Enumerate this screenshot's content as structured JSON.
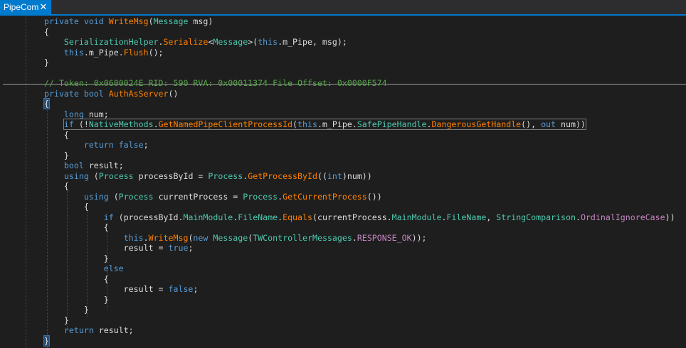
{
  "tab": {
    "title": "PipeCom",
    "close": "✕"
  },
  "code_lines": [
    [
      {
        "t": "private void ",
        "c": "kw"
      },
      {
        "t": "WriteMsg",
        "c": "mt"
      },
      {
        "t": "(",
        "c": "pl"
      },
      {
        "t": "Message",
        "c": "ty"
      },
      {
        "t": " msg)",
        "c": "pl"
      }
    ],
    [
      {
        "t": "{",
        "c": "pl"
      }
    ],
    [
      {
        "t": "    ",
        "c": "pl"
      },
      {
        "t": "SerializationHelper",
        "c": "ty"
      },
      {
        "t": ".",
        "c": "pl"
      },
      {
        "t": "Serialize",
        "c": "mt"
      },
      {
        "t": "<",
        "c": "pl"
      },
      {
        "t": "Message",
        "c": "ty"
      },
      {
        "t": ">(",
        "c": "pl"
      },
      {
        "t": "this",
        "c": "kw"
      },
      {
        "t": ".m_Pipe, msg);",
        "c": "pl"
      }
    ],
    [
      {
        "t": "    ",
        "c": "pl"
      },
      {
        "t": "this",
        "c": "kw"
      },
      {
        "t": ".m_Pipe.",
        "c": "pl"
      },
      {
        "t": "Flush",
        "c": "mt"
      },
      {
        "t": "();",
        "c": "pl"
      }
    ],
    [
      {
        "t": "}",
        "c": "pl"
      }
    ],
    [
      {
        "t": "",
        "c": "pl"
      }
    ],
    [
      {
        "t": "// Token: 0x0600024E RID: 590 RVA: 0x00011374 File Offset: 0x0000F574",
        "c": "cm"
      }
    ],
    [
      {
        "t": "private bool ",
        "c": "kw"
      },
      {
        "t": "AuthAsServer",
        "c": "mt"
      },
      {
        "t": "()",
        "c": "pl"
      }
    ],
    [
      {
        "t": "{",
        "c": "pl",
        "brace": true
      }
    ],
    [
      {
        "t": "    ",
        "c": "pl"
      },
      {
        "t": "long",
        "c": "kw"
      },
      {
        "t": " num;",
        "c": "pl"
      }
    ],
    [
      {
        "t": "    ",
        "c": "pl"
      },
      {
        "t": "if",
        "c": "kw",
        "hl": true
      },
      {
        "t": " (!",
        "c": "pl",
        "hl": true
      },
      {
        "t": "NativeMethods",
        "c": "ty",
        "hl": true
      },
      {
        "t": ".",
        "c": "pl",
        "hl": true
      },
      {
        "t": "GetNamedPipeClientProcessId",
        "c": "mt",
        "hl": true
      },
      {
        "t": "(",
        "c": "pl",
        "hl": true
      },
      {
        "t": "this",
        "c": "kw",
        "hl": true
      },
      {
        "t": ".m_Pipe.",
        "c": "pl",
        "hl": true
      },
      {
        "t": "SafePipeHandle",
        "c": "pr",
        "hl": true
      },
      {
        "t": ".",
        "c": "pl",
        "hl": true
      },
      {
        "t": "DangerousGetHandle",
        "c": "mt",
        "hl": true
      },
      {
        "t": "(), ",
        "c": "pl",
        "hl": true
      },
      {
        "t": "out",
        "c": "kw",
        "hl": true
      },
      {
        "t": " num))",
        "c": "pl",
        "hl": true
      }
    ],
    [
      {
        "t": "    {",
        "c": "pl"
      }
    ],
    [
      {
        "t": "        ",
        "c": "pl"
      },
      {
        "t": "return false",
        "c": "kw"
      },
      {
        "t": ";",
        "c": "pl"
      }
    ],
    [
      {
        "t": "    }",
        "c": "pl"
      }
    ],
    [
      {
        "t": "    ",
        "c": "pl"
      },
      {
        "t": "bool",
        "c": "kw"
      },
      {
        "t": " result;",
        "c": "pl"
      }
    ],
    [
      {
        "t": "    ",
        "c": "pl"
      },
      {
        "t": "using",
        "c": "kw"
      },
      {
        "t": " (",
        "c": "pl"
      },
      {
        "t": "Process",
        "c": "ty"
      },
      {
        "t": " processById = ",
        "c": "pl"
      },
      {
        "t": "Process",
        "c": "ty"
      },
      {
        "t": ".",
        "c": "pl"
      },
      {
        "t": "GetProcessById",
        "c": "mt"
      },
      {
        "t": "((",
        "c": "pl"
      },
      {
        "t": "int",
        "c": "kw"
      },
      {
        "t": ")num))",
        "c": "pl"
      }
    ],
    [
      {
        "t": "    {",
        "c": "pl"
      }
    ],
    [
      {
        "t": "        ",
        "c": "pl"
      },
      {
        "t": "using",
        "c": "kw"
      },
      {
        "t": " (",
        "c": "pl"
      },
      {
        "t": "Process",
        "c": "ty"
      },
      {
        "t": " currentProcess = ",
        "c": "pl"
      },
      {
        "t": "Process",
        "c": "ty"
      },
      {
        "t": ".",
        "c": "pl"
      },
      {
        "t": "GetCurrentProcess",
        "c": "mt"
      },
      {
        "t": "())",
        "c": "pl"
      }
    ],
    [
      {
        "t": "        {",
        "c": "pl"
      }
    ],
    [
      {
        "t": "            ",
        "c": "pl"
      },
      {
        "t": "if",
        "c": "kw"
      },
      {
        "t": " (processById.",
        "c": "pl"
      },
      {
        "t": "MainModule",
        "c": "pr"
      },
      {
        "t": ".",
        "c": "pl"
      },
      {
        "t": "FileName",
        "c": "pr"
      },
      {
        "t": ".",
        "c": "pl"
      },
      {
        "t": "Equals",
        "c": "mt"
      },
      {
        "t": "(currentProcess.",
        "c": "pl"
      },
      {
        "t": "MainModule",
        "c": "pr"
      },
      {
        "t": ".",
        "c": "pl"
      },
      {
        "t": "FileName",
        "c": "pr"
      },
      {
        "t": ", ",
        "c": "pl"
      },
      {
        "t": "StringComparison",
        "c": "ty"
      },
      {
        "t": ".",
        "c": "pl"
      },
      {
        "t": "OrdinalIgnoreCase",
        "c": "en"
      },
      {
        "t": "))",
        "c": "pl"
      }
    ],
    [
      {
        "t": "            {",
        "c": "pl"
      }
    ],
    [
      {
        "t": "                ",
        "c": "pl"
      },
      {
        "t": "this",
        "c": "kw"
      },
      {
        "t": ".",
        "c": "pl"
      },
      {
        "t": "WriteMsg",
        "c": "mt"
      },
      {
        "t": "(",
        "c": "pl"
      },
      {
        "t": "new",
        "c": "kw"
      },
      {
        "t": " ",
        "c": "pl"
      },
      {
        "t": "Message",
        "c": "ty"
      },
      {
        "t": "(",
        "c": "pl"
      },
      {
        "t": "TWControllerMessages",
        "c": "ty"
      },
      {
        "t": ".",
        "c": "pl"
      },
      {
        "t": "RESPONSE_OK",
        "c": "en"
      },
      {
        "t": "));",
        "c": "pl"
      }
    ],
    [
      {
        "t": "                result = ",
        "c": "pl"
      },
      {
        "t": "true",
        "c": "kw"
      },
      {
        "t": ";",
        "c": "pl"
      }
    ],
    [
      {
        "t": "            }",
        "c": "pl"
      }
    ],
    [
      {
        "t": "            ",
        "c": "pl"
      },
      {
        "t": "else",
        "c": "kw"
      }
    ],
    [
      {
        "t": "            {",
        "c": "pl"
      }
    ],
    [
      {
        "t": "                result = ",
        "c": "pl"
      },
      {
        "t": "false",
        "c": "kw"
      },
      {
        "t": ";",
        "c": "pl"
      }
    ],
    [
      {
        "t": "            }",
        "c": "pl"
      }
    ],
    [
      {
        "t": "        }",
        "c": "pl"
      }
    ],
    [
      {
        "t": "    }",
        "c": "pl"
      }
    ],
    [
      {
        "t": "    ",
        "c": "pl"
      },
      {
        "t": "return",
        "c": "kw"
      },
      {
        "t": " result;",
        "c": "pl"
      }
    ],
    [
      {
        "t": "}",
        "c": "pl",
        "brace": true
      }
    ]
  ]
}
